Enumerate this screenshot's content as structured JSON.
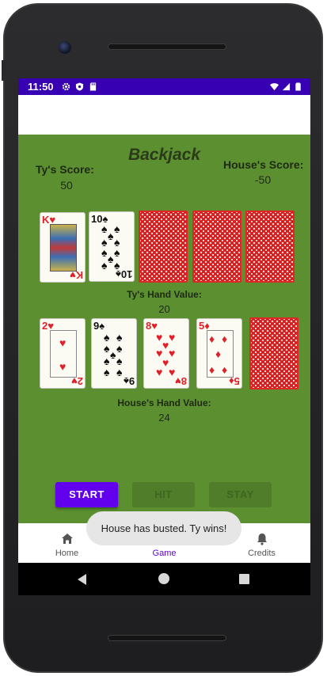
{
  "status_bar": {
    "time": "11:50",
    "icons_left": [
      "gear-icon",
      "shield-icon",
      "sd-card-icon"
    ],
    "icons_right": [
      "wifi-icon",
      "signal-icon",
      "battery-icon"
    ]
  },
  "game": {
    "title": "Backjack",
    "player_score_label": "Ty's Score:",
    "player_score": "50",
    "house_score_label": "House's Score:",
    "house_score": "-50",
    "player_hand_label": "Ty's Hand Value:",
    "player_hand_value": "20",
    "house_hand_label": "House's Hand Value:",
    "house_hand_value": "24",
    "player_cards": [
      {
        "rank": "K",
        "suit": "♥",
        "color": "red"
      },
      {
        "rank": "10",
        "suit": "♠",
        "color": "black"
      },
      {
        "rank": "",
        "suit": "",
        "color": "back"
      },
      {
        "rank": "",
        "suit": "",
        "color": "back"
      },
      {
        "rank": "",
        "suit": "",
        "color": "back"
      }
    ],
    "house_cards": [
      {
        "rank": "2",
        "suit": "♥",
        "color": "red"
      },
      {
        "rank": "9",
        "suit": "♠",
        "color": "black"
      },
      {
        "rank": "8",
        "suit": "♥",
        "color": "red"
      },
      {
        "rank": "5",
        "suit": "♦",
        "color": "red"
      },
      {
        "rank": "",
        "suit": "",
        "color": "back"
      }
    ]
  },
  "buttons": {
    "start": "START",
    "hit": "HIT",
    "stay": "STAY"
  },
  "bottom_nav": [
    {
      "label": "Home",
      "icon": "home-icon",
      "active": false
    },
    {
      "label": "Game",
      "icon": "game-icon",
      "active": true
    },
    {
      "label": "Credits",
      "icon": "bell-icon",
      "active": false
    }
  ],
  "toast": "House has busted. Ty wins!",
  "colors": {
    "status_bar": "#3700b3",
    "felt": "#5b8f30",
    "primary": "#6200ee",
    "card_back": "#d32020"
  }
}
